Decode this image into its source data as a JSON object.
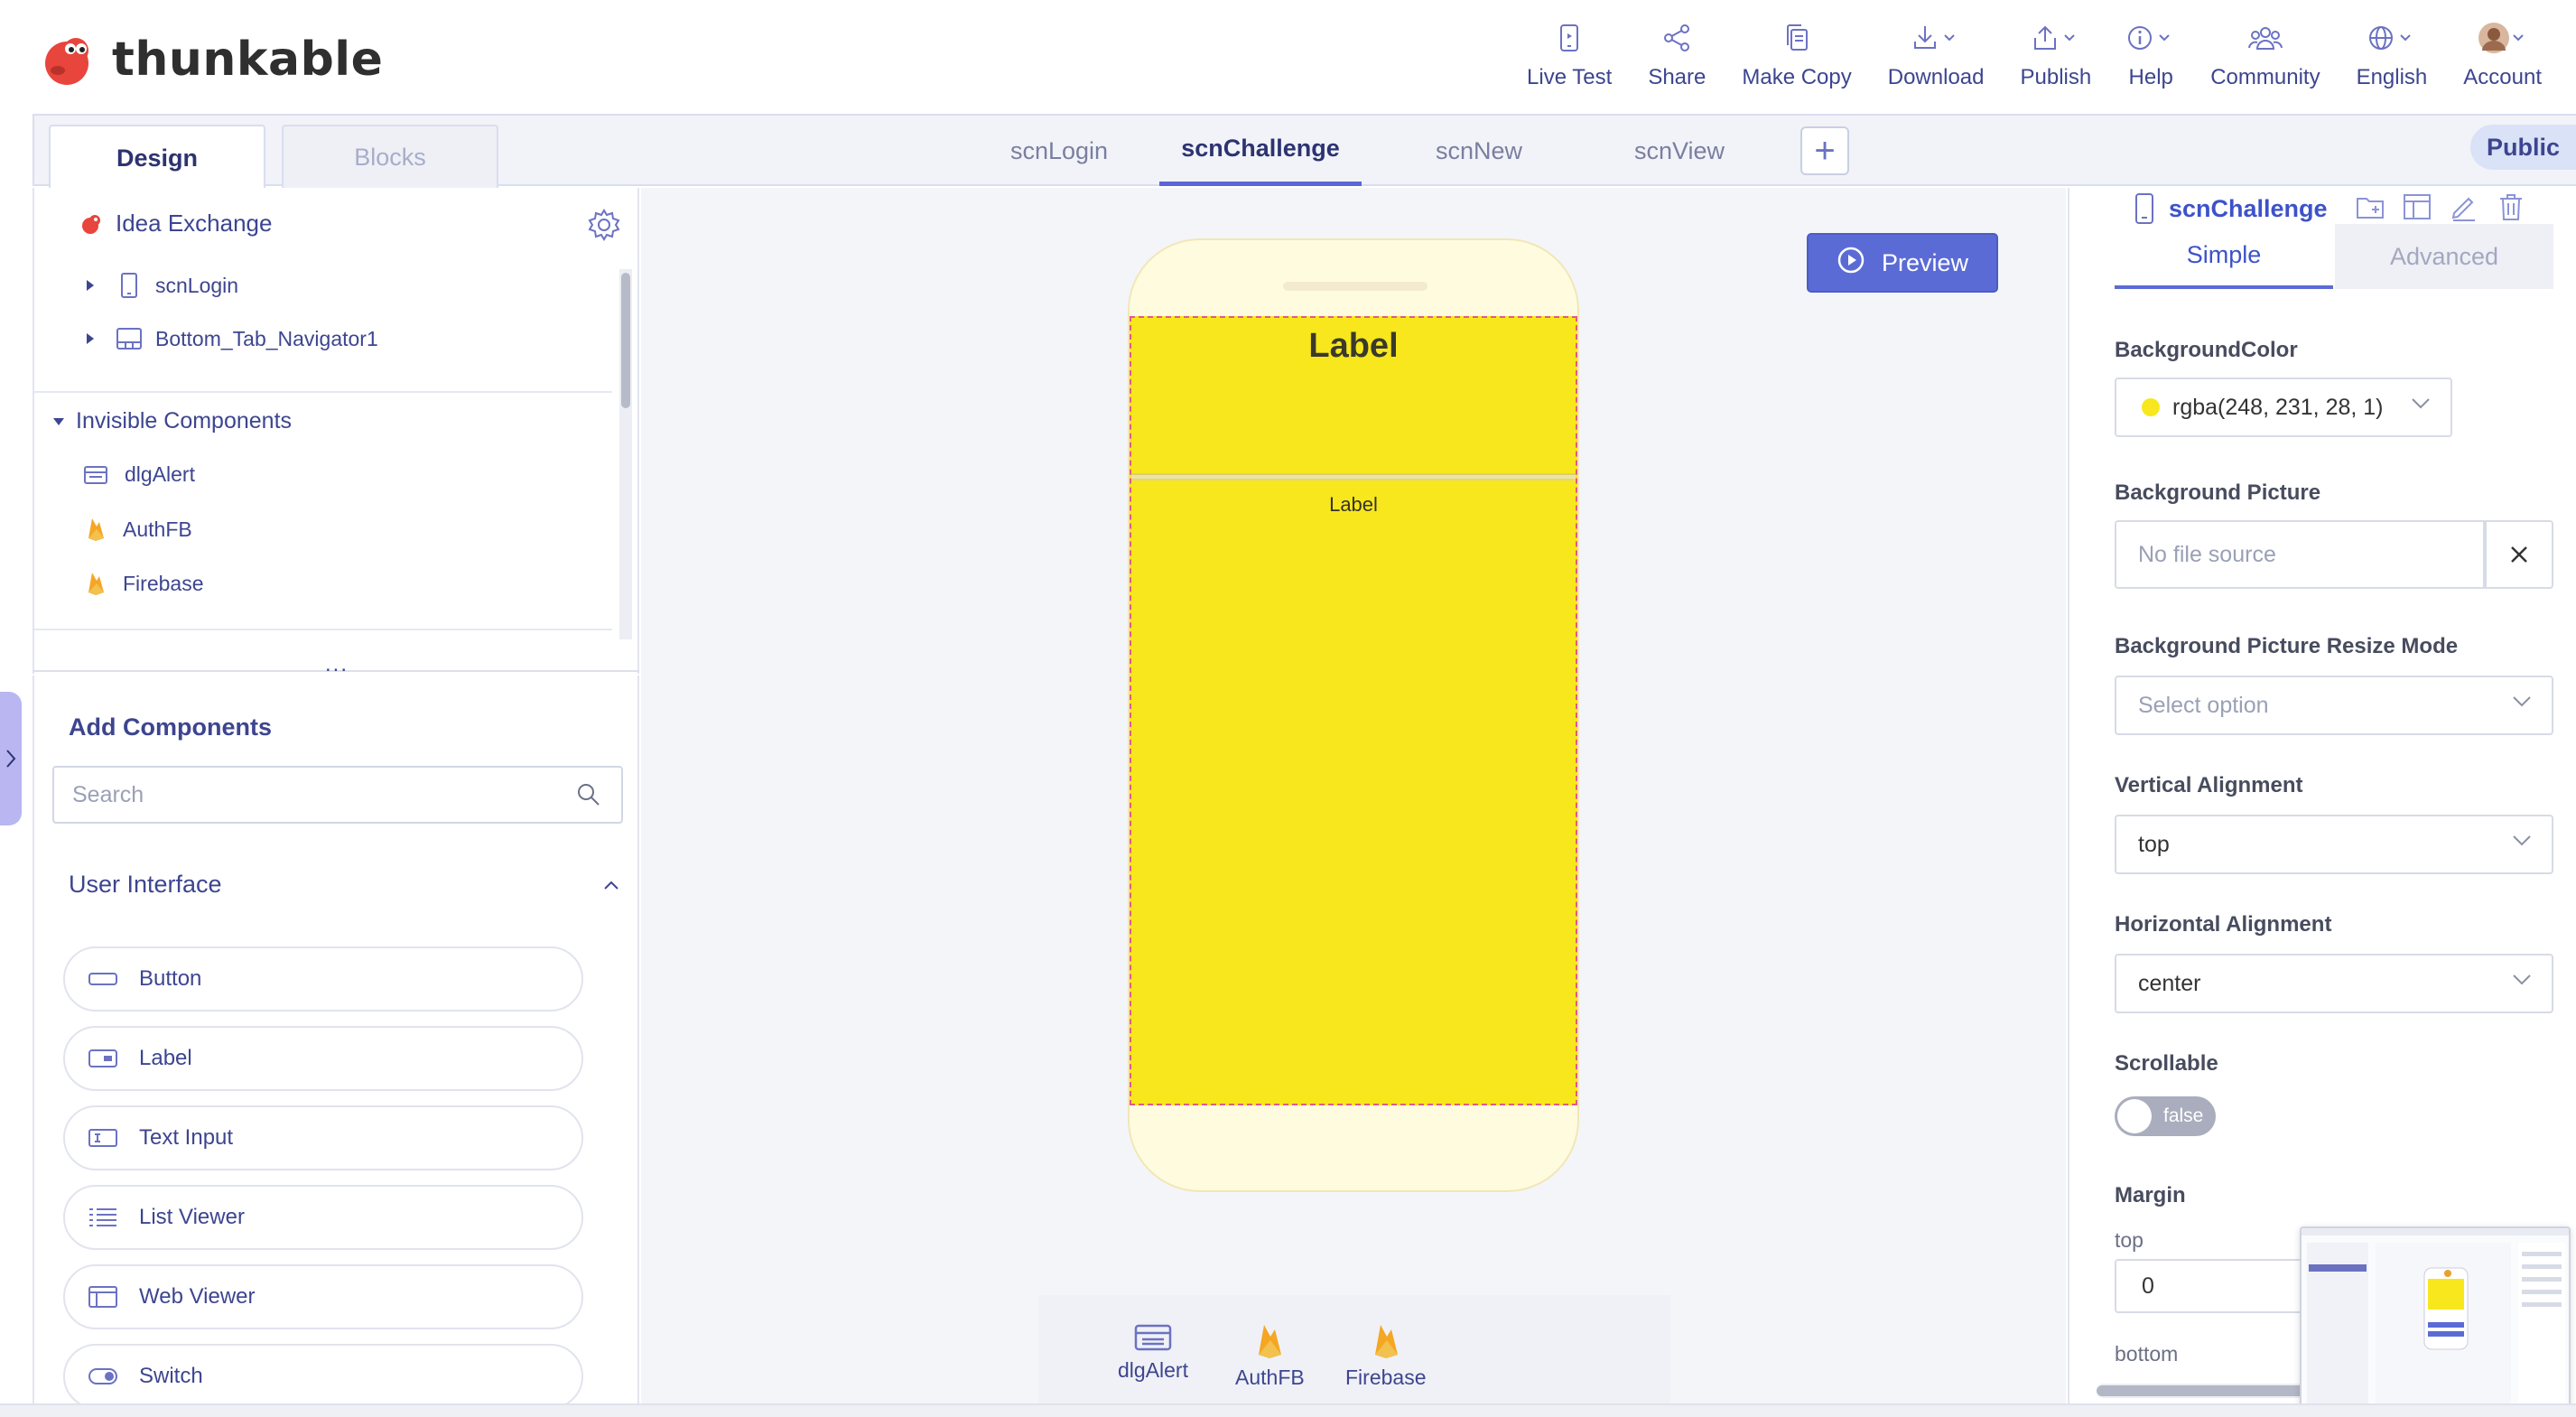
{
  "app": {
    "brand": "thunkable"
  },
  "topnav": [
    {
      "key": "live_test",
      "label": "Live Test",
      "icon": "phone-icon"
    },
    {
      "key": "share",
      "label": "Share",
      "icon": "share-icon"
    },
    {
      "key": "make_copy",
      "label": "Make Copy",
      "icon": "copy-icon"
    },
    {
      "key": "download",
      "label": "Download",
      "icon": "download-icon"
    },
    {
      "key": "publish",
      "label": "Publish",
      "icon": "publish-icon"
    },
    {
      "key": "help",
      "label": "Help",
      "icon": "info-icon"
    },
    {
      "key": "community",
      "label": "Community",
      "icon": "community-icon"
    },
    {
      "key": "english",
      "label": "English",
      "icon": "globe-icon"
    },
    {
      "key": "account",
      "label": "Account",
      "icon": "avatar"
    }
  ],
  "modes": {
    "design": "Design",
    "blocks": "Blocks"
  },
  "screen_tabs": [
    "scnLogin",
    "scnChallenge",
    "scnNew",
    "scnView"
  ],
  "active_screen_tab": "scnChallenge",
  "visibility": "Public",
  "tree": {
    "root": "Idea Exchange",
    "items": [
      "scnLogin",
      "Bottom_Tab_Navigator1"
    ],
    "invisible_header": "Invisible Components",
    "invisible": [
      "dlgAlert",
      "AuthFB",
      "Firebase"
    ],
    "more": "..."
  },
  "add_components": {
    "title": "Add Components",
    "search_placeholder": "Search",
    "section": "User Interface",
    "items": [
      "Button",
      "Label",
      "Text Input",
      "List Viewer",
      "Web Viewer",
      "Switch"
    ]
  },
  "canvas": {
    "preview_label": "Preview",
    "label_big": "Label",
    "label_small": "Label",
    "screen_color": "#f8e71c",
    "tray": [
      "dlgAlert",
      "AuthFB",
      "Firebase"
    ]
  },
  "properties": {
    "title": "scnChallenge",
    "tabs": {
      "simple": "Simple",
      "advanced": "Advanced"
    },
    "bg_color_label": "BackgroundColor",
    "bg_color_value": "rgba(248, 231, 28, 1)",
    "bg_picture_label": "Background Picture",
    "bg_picture_placeholder": "No file source",
    "resize_label": "Background Picture Resize Mode",
    "resize_placeholder": "Select option",
    "valign_label": "Vertical Alignment",
    "valign_value": "top",
    "halign_label": "Horizontal Alignment",
    "halign_value": "center",
    "scrollable_label": "Scrollable",
    "scrollable_value": "false",
    "margin_label": "Margin",
    "margin_top_label": "top",
    "margin_top_value": "0",
    "margin_bottom_label": "bottom"
  }
}
